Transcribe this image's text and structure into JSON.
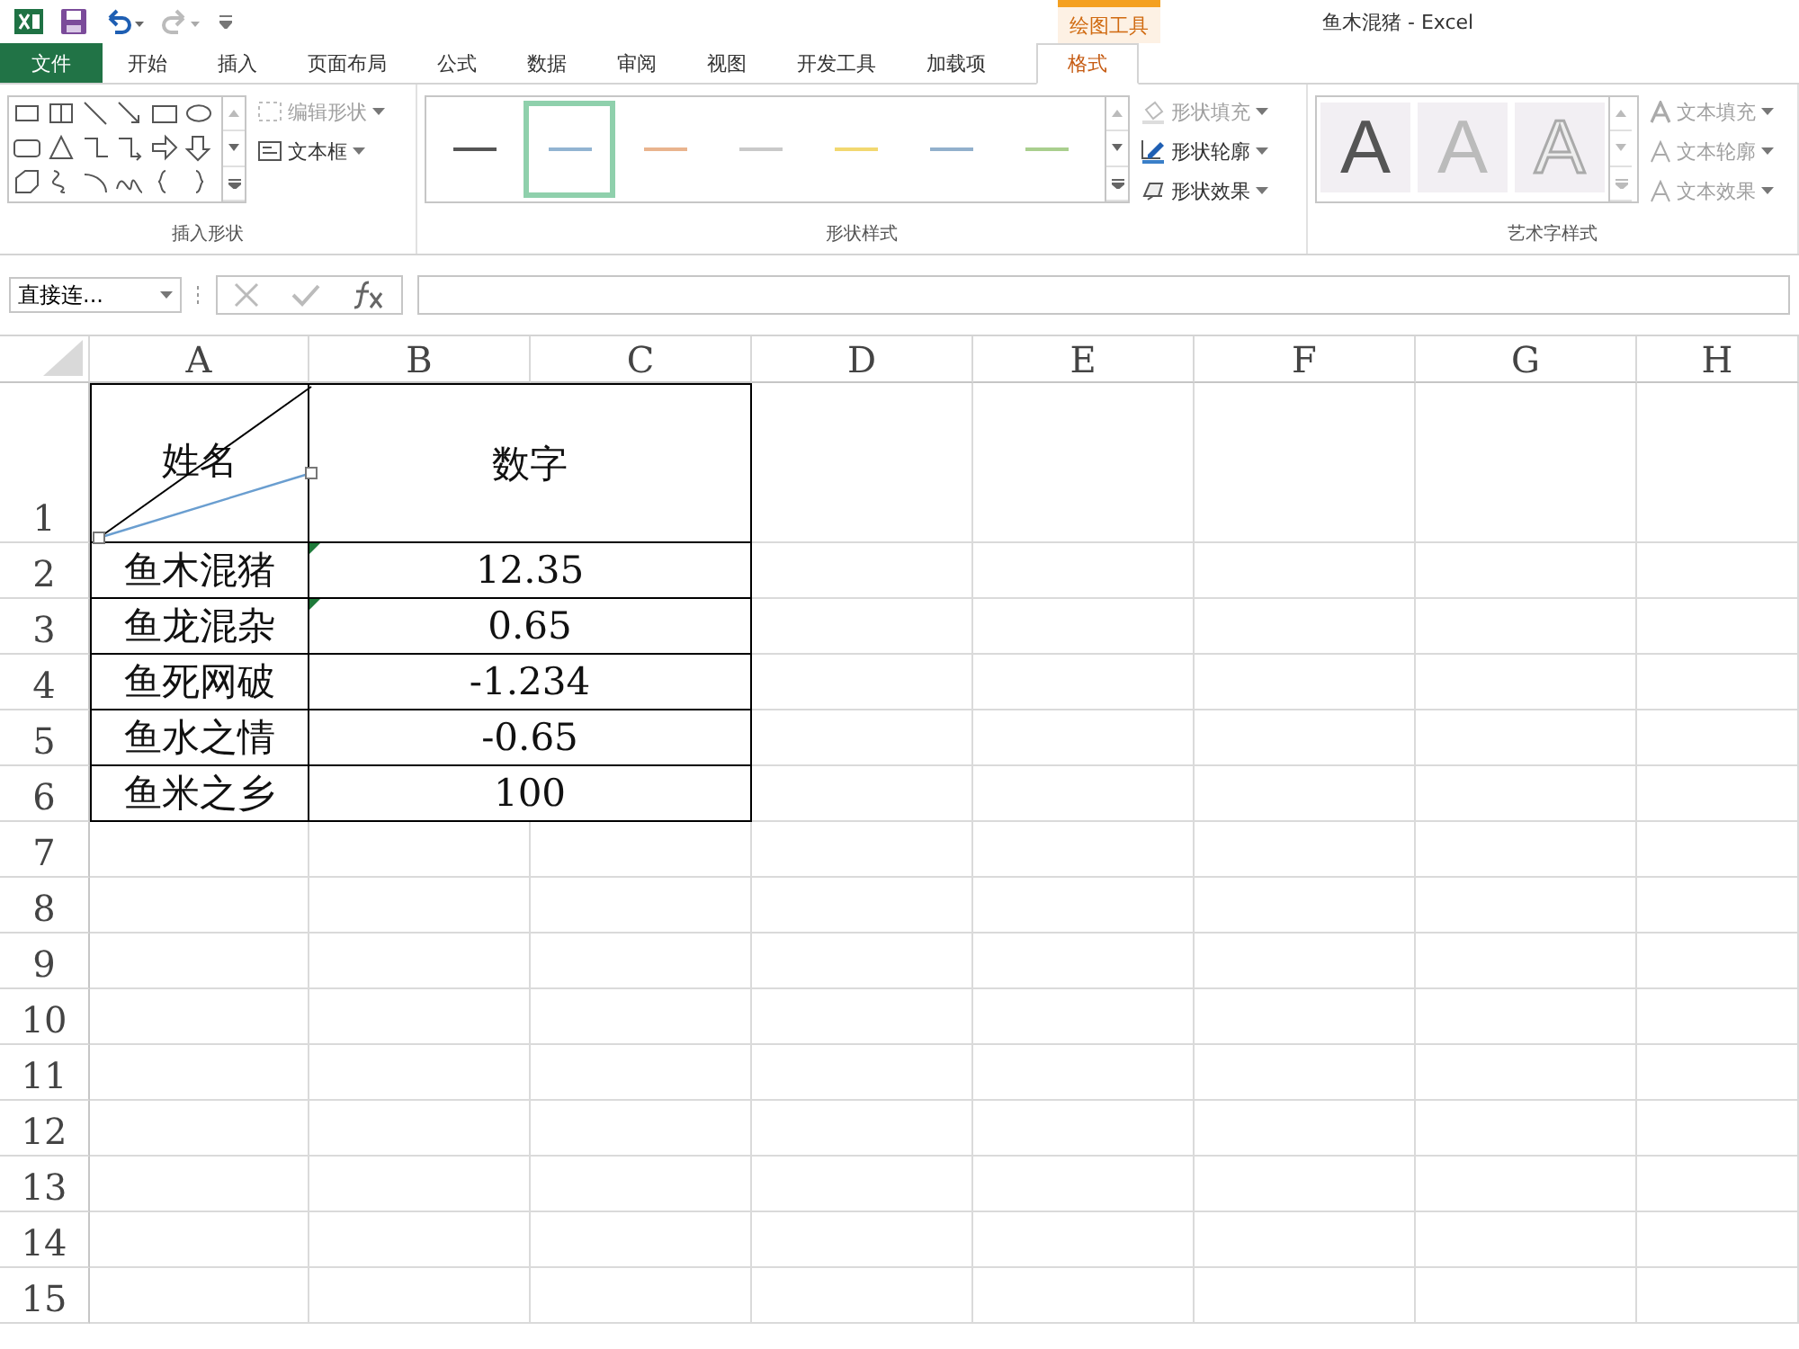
{
  "window": {
    "title": "鱼木混猪 - Excel",
    "context_group": "绘图工具"
  },
  "tabs": [
    {
      "label": "文件",
      "kind": "file",
      "selected": false
    },
    {
      "label": "开始",
      "kind": "normal",
      "selected": false
    },
    {
      "label": "插入",
      "kind": "normal",
      "selected": false
    },
    {
      "label": "页面布局",
      "kind": "normal",
      "selected": false
    },
    {
      "label": "公式",
      "kind": "normal",
      "selected": false
    },
    {
      "label": "数据",
      "kind": "normal",
      "selected": false
    },
    {
      "label": "审阅",
      "kind": "normal",
      "selected": false
    },
    {
      "label": "视图",
      "kind": "normal",
      "selected": false
    },
    {
      "label": "开发工具",
      "kind": "normal",
      "selected": false
    },
    {
      "label": "加载项",
      "kind": "normal",
      "selected": false
    },
    {
      "label": "格式",
      "kind": "context",
      "selected": true
    }
  ],
  "ribbon": {
    "insert_shapes": {
      "title": "插入形状",
      "commands": [
        {
          "label": "编辑形状",
          "disabled": true
        },
        {
          "label": "文本框",
          "disabled": false
        }
      ]
    },
    "shape_styles": {
      "title": "形状样式",
      "styles": [
        {
          "color": "#555555",
          "selected": false
        },
        {
          "color": "#92b4d2",
          "selected": true
        },
        {
          "color": "#e9b48e",
          "selected": false
        },
        {
          "color": "#c9c9c9",
          "selected": false
        },
        {
          "color": "#f2d870",
          "selected": false
        },
        {
          "color": "#92b0cc",
          "selected": false
        },
        {
          "color": "#a9cf8e",
          "selected": false
        }
      ],
      "commands": [
        {
          "label": "形状填充",
          "disabled": true
        },
        {
          "label": "形状轮廓",
          "disabled": false
        },
        {
          "label": "形状效果",
          "disabled": false
        }
      ]
    },
    "wordart_styles": {
      "title": "艺术字样式",
      "samples": [
        {
          "text": "A",
          "kind": "solid"
        },
        {
          "text": "A",
          "kind": "faded"
        },
        {
          "text": "A",
          "kind": "outline"
        }
      ],
      "commands": [
        {
          "label": "文本填充",
          "disabled": true
        },
        {
          "label": "文本轮廓",
          "disabled": true
        },
        {
          "label": "文本效果",
          "disabled": true
        }
      ]
    }
  },
  "formula_bar": {
    "name_box": "直接连..."
  },
  "sheet": {
    "columns": [
      "A",
      "B",
      "C",
      "D",
      "E",
      "F",
      "G",
      "H"
    ],
    "row_numbers": [
      "1",
      "2",
      "3",
      "4",
      "5",
      "6",
      "7",
      "8",
      "9",
      "10",
      "11",
      "12",
      "13",
      "14",
      "15"
    ],
    "header": {
      "name": "姓名",
      "value": "数字"
    },
    "rows": [
      {
        "name": "鱼木混猪",
        "value": "12.35",
        "flagged": true
      },
      {
        "name": "鱼龙混杂",
        "value": "0.65",
        "flagged": true
      },
      {
        "name": "鱼死网破",
        "value": "-1.234",
        "flagged": false
      },
      {
        "name": "鱼水之情",
        "value": "-0.65",
        "flagged": false
      },
      {
        "name": "鱼米之乡",
        "value": "100",
        "flagged": false
      }
    ]
  }
}
